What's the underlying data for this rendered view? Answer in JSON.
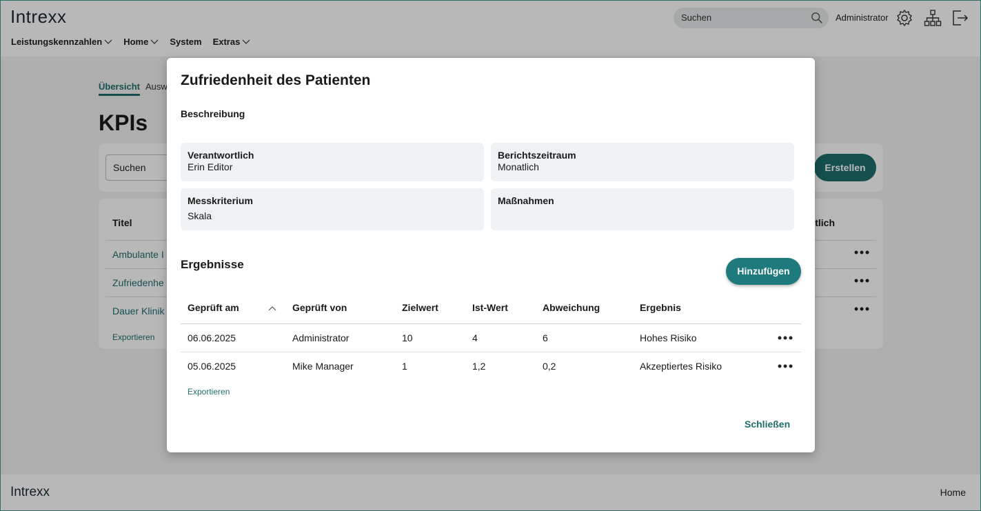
{
  "header": {
    "logo": "Intrexx",
    "search_text": "Suchen",
    "user": "Administrator",
    "nav": [
      "Leistungskennzahlen",
      "Home",
      "System",
      "Extras"
    ]
  },
  "page": {
    "tab_active": "Übersicht",
    "tab_other": "Auswe",
    "title": "KPIs",
    "search_text": "Suchen",
    "create_label": "Erstellen",
    "table_header": "Titel",
    "table_header_right": "tlich",
    "rows": [
      "Ambulante I",
      "Zufriedenhe",
      "Dauer Klinik"
    ],
    "export": "Exportieren"
  },
  "footer": {
    "logo": "Intrexx",
    "home": "Home"
  },
  "dialog": {
    "title": "Zufriedenheit des Patienten",
    "description_label": "Beschreibung",
    "fields": {
      "owner_label": "Verantwortlich",
      "owner_value": "Erin Editor",
      "period_label": "Berichtszeitraum",
      "period_value": "Monatlich",
      "criterion_label": "Messkriterium",
      "criterion_value": "Skala",
      "measures_label": "Maßnahmen"
    },
    "results_label": "Ergebnisse",
    "add_label": "Hinzufügen",
    "columns": [
      "Geprüft am",
      "Geprüft von",
      "Zielwert",
      "Ist-Wert",
      "Abweichung",
      "Ergebnis"
    ],
    "rows": [
      [
        "06.06.2025",
        "Administrator",
        "10",
        "4",
        "6",
        "Hohes Risiko"
      ],
      [
        "05.06.2025",
        "Mike Manager",
        "1",
        "1,2",
        "0,2",
        "Akzeptiertes Risiko"
      ]
    ],
    "export": "Exportieren",
    "close_label": "Schließen"
  }
}
